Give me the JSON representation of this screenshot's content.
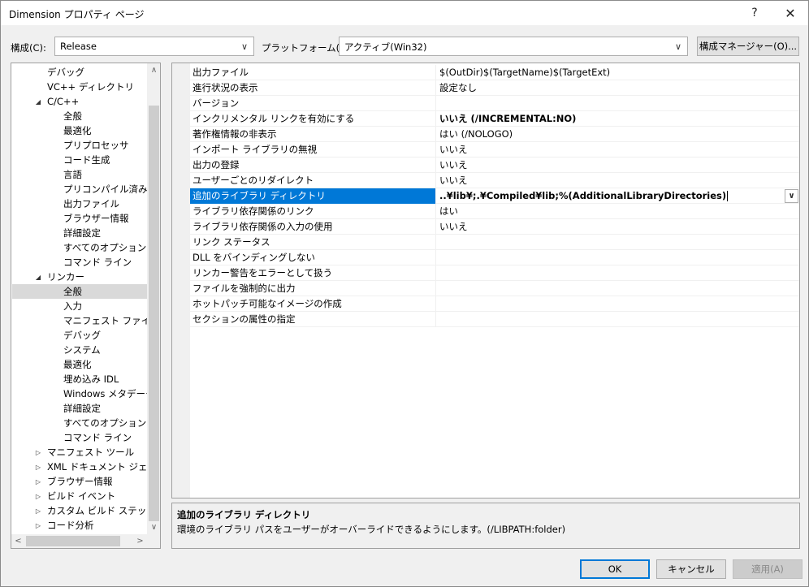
{
  "window": {
    "title": "Dimension プロパティ ページ",
    "help_glyph": "?",
    "close_glyph": "✕"
  },
  "config_bar": {
    "config_label": "構成(C):",
    "config_value": "Release",
    "platform_label": "プラットフォーム(P):",
    "platform_value": "アクティブ(Win32)",
    "config_manager_label": "構成マネージャー(O)..."
  },
  "tree": {
    "items": [
      {
        "label": "デバッグ",
        "level": 1
      },
      {
        "label": "VC++ ディレクトリ",
        "level": 1
      },
      {
        "label": "C/C++",
        "level": 1,
        "expander": "◢"
      },
      {
        "label": "全般",
        "level": 2
      },
      {
        "label": "最適化",
        "level": 2
      },
      {
        "label": "プリプロセッサ",
        "level": 2
      },
      {
        "label": "コード生成",
        "level": 2
      },
      {
        "label": "言語",
        "level": 2
      },
      {
        "label": "プリコンパイル済みヘッ",
        "level": 2
      },
      {
        "label": "出力ファイル",
        "level": 2
      },
      {
        "label": "ブラウザー情報",
        "level": 2
      },
      {
        "label": "詳細設定",
        "level": 2
      },
      {
        "label": "すべてのオプション",
        "level": 2
      },
      {
        "label": "コマンド ライン",
        "level": 2
      },
      {
        "label": "リンカー",
        "level": 1,
        "expander": "◢"
      },
      {
        "label": "全般",
        "level": 2,
        "selected": true
      },
      {
        "label": "入力",
        "level": 2
      },
      {
        "label": "マニフェスト ファイル",
        "level": 2
      },
      {
        "label": "デバッグ",
        "level": 2
      },
      {
        "label": "システム",
        "level": 2
      },
      {
        "label": "最適化",
        "level": 2
      },
      {
        "label": "埋め込み IDL",
        "level": 2
      },
      {
        "label": "Windows メタデータ",
        "level": 2
      },
      {
        "label": "詳細設定",
        "level": 2
      },
      {
        "label": "すべてのオプション",
        "level": 2
      },
      {
        "label": "コマンド ライン",
        "level": 2
      },
      {
        "label": "マニフェスト ツール",
        "level": 1,
        "expander": "▷"
      },
      {
        "label": "XML ドキュメント ジェネレー",
        "level": 1,
        "expander": "▷"
      },
      {
        "label": "ブラウザー情報",
        "level": 1,
        "expander": "▷"
      },
      {
        "label": "ビルド イベント",
        "level": 1,
        "expander": "▷"
      },
      {
        "label": "カスタム ビルド ステップ",
        "level": 1,
        "expander": "▷"
      },
      {
        "label": "コード分析",
        "level": 1,
        "expander": "▷"
      }
    ],
    "scroll_up": "∧",
    "scroll_down": "∨",
    "scroll_left": "<",
    "scroll_right": ">"
  },
  "properties": [
    {
      "name": "出力ファイル",
      "value": "$(OutDir)$(TargetName)$(TargetExt)"
    },
    {
      "name": "進行状況の表示",
      "value": "設定なし"
    },
    {
      "name": "バージョン",
      "value": ""
    },
    {
      "name": "インクリメンタル リンクを有効にする",
      "value": "いいえ (/INCREMENTAL:NO)",
      "bold": true
    },
    {
      "name": "著作権情報の非表示",
      "value": "はい (/NOLOGO)"
    },
    {
      "name": "インポート ライブラリの無視",
      "value": "いいえ"
    },
    {
      "name": "出力の登録",
      "value": "いいえ"
    },
    {
      "name": "ユーザーごとのリダイレクト",
      "value": "いいえ"
    },
    {
      "name": "追加のライブラリ ディレクトリ",
      "value": "..¥lib¥;.¥Compiled¥lib;%(AdditionalLibraryDirectories)",
      "bold": true,
      "selected": true
    },
    {
      "name": "ライブラリ依存関係のリンク",
      "value": "はい"
    },
    {
      "name": "ライブラリ依存関係の入力の使用",
      "value": "いいえ"
    },
    {
      "name": "リンク ステータス",
      "value": ""
    },
    {
      "name": "DLL をバインディングしない",
      "value": ""
    },
    {
      "name": "リンカー警告をエラーとして扱う",
      "value": ""
    },
    {
      "name": "ファイルを強制的に出力",
      "value": ""
    },
    {
      "name": "ホットパッチ可能なイメージの作成",
      "value": ""
    },
    {
      "name": "セクションの属性の指定",
      "value": ""
    }
  ],
  "description": {
    "title": "追加のライブラリ ディレクトリ",
    "text": "環境のライブラリ パスをユーザーがオーバーライドできるようにします。(/LIBPATH:folder)"
  },
  "footer": {
    "ok_label": "OK",
    "cancel_label": "キャンセル",
    "apply_label": "適用(A)"
  },
  "icons": {
    "dropdown": "∨"
  }
}
